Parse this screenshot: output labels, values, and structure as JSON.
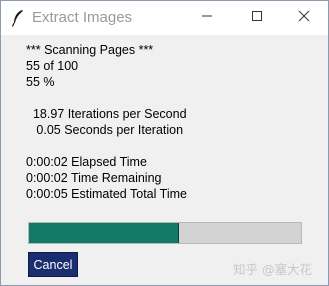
{
  "window": {
    "title": "Extract Images",
    "icon": "feather-icon",
    "controls": [
      "minimize-icon",
      "maximize-icon",
      "close-icon"
    ]
  },
  "status": {
    "header": "*** Scanning Pages ***",
    "count": "55 of 100",
    "percent_text": "55 %",
    "rate": "  18.97 Iterations per Second",
    "per_iter": "   0.05 Seconds per Iteration",
    "elapsed": "0:00:02 Elapsed Time",
    "remaining": "0:00:02 Time Remaining",
    "total": "0:00:05 Estimated Total Time"
  },
  "progress": {
    "value": 0.55,
    "fill_color": "#117b67",
    "track_color": "#d3d3d3"
  },
  "buttons": {
    "cancel_label": "Cancel"
  },
  "watermark": "知乎 @塞大花"
}
